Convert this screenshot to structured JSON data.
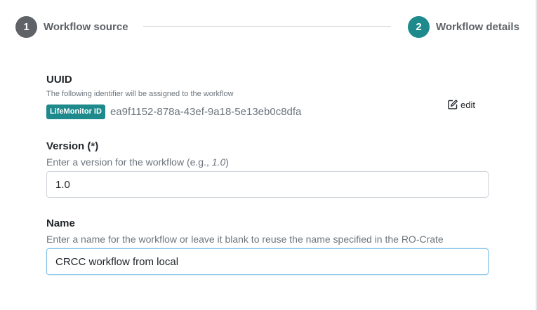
{
  "stepper": {
    "steps": [
      {
        "number": "1",
        "label": "Workflow source"
      },
      {
        "number": "2",
        "label": "Workflow details"
      }
    ],
    "colors": {
      "inactive": "#5f6368",
      "active": "#1f8a8c"
    }
  },
  "uuid": {
    "title": "UUID",
    "help": "The following identifier will be assigned to the workflow",
    "badge": "LifeMonitor ID",
    "badge_color": "#1f8a8c",
    "value": "ea9f1152-878a-43ef-9a18-5e13eb0c8dfa",
    "edit_label": "edit"
  },
  "version": {
    "title": "Version (",
    "required_mark": "*",
    "title_close": ")",
    "help_prefix": "Enter a version for the workflow (e.g., ",
    "help_example": "1.0",
    "help_suffix": ")",
    "value": "1.0"
  },
  "name": {
    "title": "Name",
    "help": "Enter a name for the workflow or leave it blank to reuse the name specified in the RO-Crate",
    "value": "CRCC workflow from local"
  }
}
